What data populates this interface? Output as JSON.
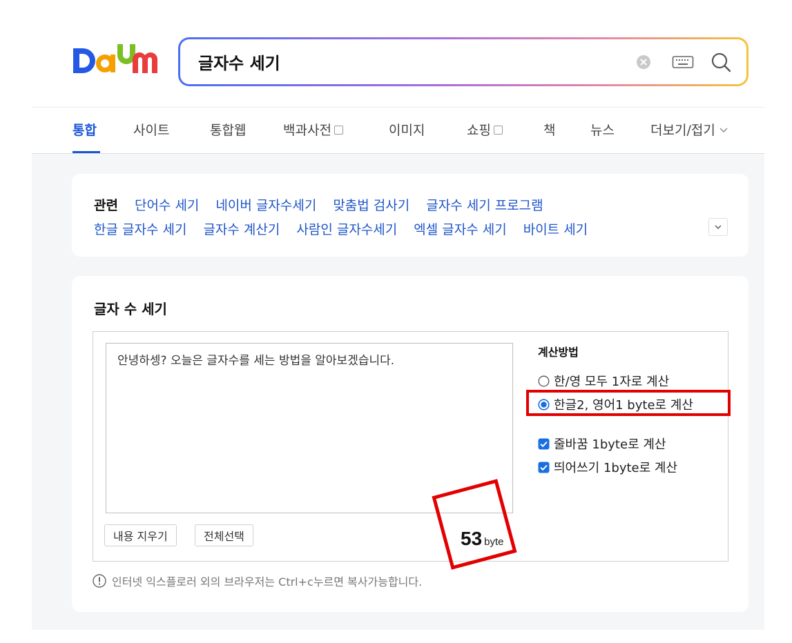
{
  "header": {
    "logo_text": "Daum",
    "search": {
      "value": "글자수 세기",
      "placeholder": ""
    },
    "icons": {
      "clear": "clear-circle-icon",
      "keyboard": "keyboard-icon",
      "search": "magnifier-icon"
    },
    "colors": {
      "accent": "#1a55d6",
      "logo_blue": "#2458e5",
      "logo_orange": "#f5a000",
      "logo_green": "#7cbf25",
      "logo_red": "#e93c3c"
    }
  },
  "tabs": [
    {
      "label": "통합",
      "active": true
    },
    {
      "label": "사이트"
    },
    {
      "label": "통합웹"
    },
    {
      "label": "백과사전",
      "has_box": true
    },
    {
      "label": "이미지"
    },
    {
      "label": "쇼핑",
      "has_box": true
    },
    {
      "label": "책"
    },
    {
      "label": "뉴스"
    },
    {
      "label": "더보기/접기",
      "has_chevron": true
    }
  ],
  "related": {
    "label": "관련",
    "row1": [
      "단어수 세기",
      "네이버 글자수세기",
      "맞춤법 검사기",
      "글자수 세기 프로그램"
    ],
    "row2": [
      "한글 글자수 세기",
      "글자수 계산기",
      "사람인 글자수세기",
      "엑셀 글자수 세기",
      "바이트 세기"
    ]
  },
  "counter": {
    "title": "글자 수 세기",
    "text": "안녕하셍? 오늘은 글자수를 세는 방법을 알아보겠습니다.",
    "clear_button": "내용 지우기",
    "select_all_button": "전체선택",
    "byte_value": "53",
    "byte_unit": "byte",
    "method_title": "계산방법",
    "method_option_1": "한/영 모두 1자로 계산",
    "method_option_2": "한글2, 영어1 byte로 계산",
    "selected_method": 2,
    "checkbox_newline": "줄바꿈 1byte로 계산",
    "checkbox_space": "띄어쓰기 1byte로 계산",
    "newline_checked": true,
    "space_checked": true,
    "notice": "인터넷 익스플로러 외의 브라우저는 Ctrl+c누르면 복사가능합니다."
  }
}
